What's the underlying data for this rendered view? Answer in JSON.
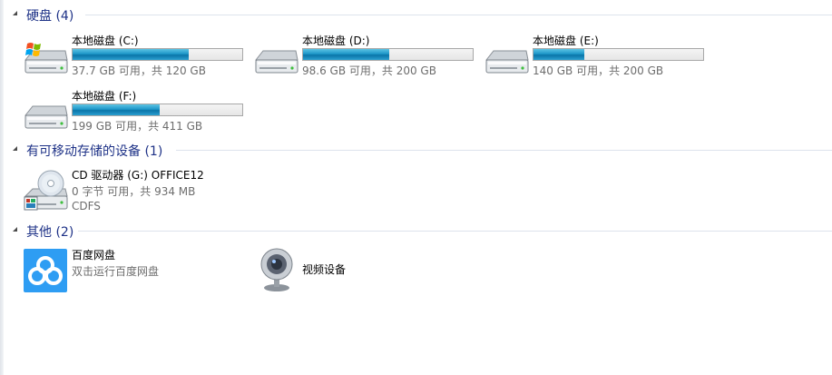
{
  "hard_disks": {
    "header": "硬盘 (4)",
    "drives": [
      {
        "name": "本地磁盘 (C:)",
        "free_text": "37.7 GB 可用，共 120 GB",
        "used_fraction": 0.686,
        "icon": "windows-drive-icon"
      },
      {
        "name": "本地磁盘 (D:)",
        "free_text": "98.6 GB 可用，共 200 GB",
        "used_fraction": 0.507,
        "icon": "hard-drive-icon"
      },
      {
        "name": "本地磁盘 (E:)",
        "free_text": "140 GB 可用，共 200 GB",
        "used_fraction": 0.3,
        "icon": "hard-drive-icon"
      },
      {
        "name": "本地磁盘 (F:)",
        "free_text": "199 GB 可用，共 411 GB",
        "used_fraction": 0.516,
        "icon": "hard-drive-icon"
      }
    ]
  },
  "removable": {
    "header": "有可移动存储的设备 (1)",
    "devices": [
      {
        "name": "CD 驱动器 (G:) OFFICE12",
        "free_text": "0 字节 可用，共 934 MB",
        "fs": "CDFS",
        "icon": "cd-drive-icon"
      }
    ]
  },
  "other": {
    "header": "其他 (2)",
    "items": [
      {
        "name": "百度网盘",
        "desc": "双击运行百度网盘",
        "icon": "baidu-netdisk-icon"
      },
      {
        "name": "视频设备",
        "desc": "",
        "icon": "webcam-icon"
      }
    ]
  },
  "colors": {
    "group_title": "#1e3287",
    "bar_fill": "#1d97c9",
    "baidu_blue": "#2e9df3"
  }
}
